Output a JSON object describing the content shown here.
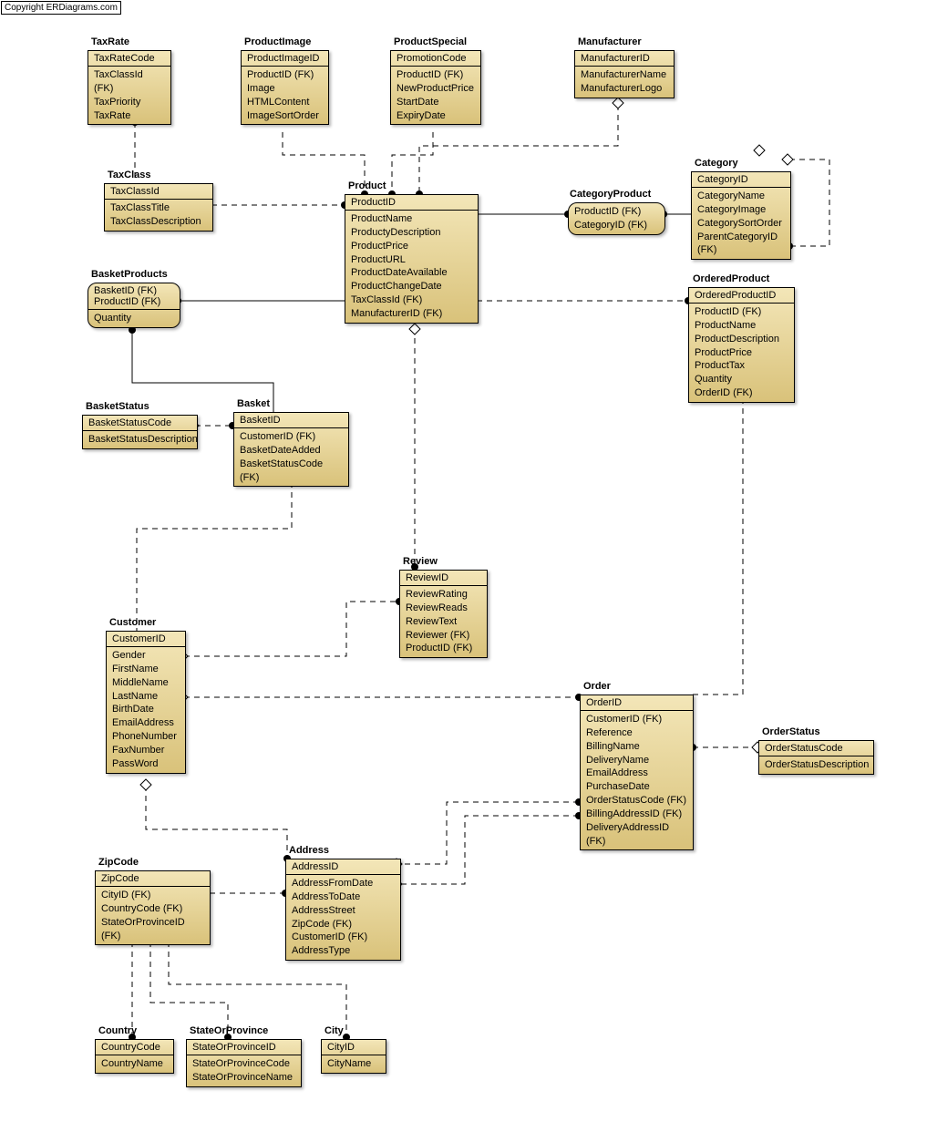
{
  "copyright": "Copyright ERDiagrams.com",
  "entities": {
    "TaxRate": {
      "title": "TaxRate",
      "pk": "TaxRateCode",
      "a1": "TaxClassId (FK)",
      "a2": "TaxPriority",
      "a3": "TaxRate"
    },
    "ProductImage": {
      "title": "ProductImage",
      "pk": "ProductImageID",
      "a1": "ProductID (FK)",
      "a2": "Image",
      "a3": "HTMLContent",
      "a4": "ImageSortOrder"
    },
    "ProductSpecial": {
      "title": "ProductSpecial",
      "pk": "PromotionCode",
      "a1": "ProductID (FK)",
      "a2": "NewProductPrice",
      "a3": "StartDate",
      "a4": "ExpiryDate"
    },
    "Manufacturer": {
      "title": "Manufacturer",
      "pk": "ManufacturerID",
      "a1": "ManufacturerName",
      "a2": "ManufacturerLogo"
    },
    "TaxClass": {
      "title": "TaxClass",
      "pk": "TaxClassId",
      "a1": "TaxClassTitle",
      "a2": "TaxClassDescription"
    },
    "Product": {
      "title": "Product",
      "pk": "ProductID",
      "a1": "ProductName",
      "a2": "ProductyDescription",
      "a3": "ProductPrice",
      "a4": "ProductURL",
      "a5": "ProductDateAvailable",
      "a6": "ProductChangeDate",
      "a7": "TaxClassId (FK)",
      "a8": "ManufacturerID (FK)"
    },
    "CategoryProduct": {
      "title": "CategoryProduct",
      "pk1": "ProductID (FK)",
      "pk2": "CategoryID (FK)"
    },
    "Category": {
      "title": "Category",
      "pk": "CategoryID",
      "a1": "CategoryName",
      "a2": "CategoryImage",
      "a3": "CategorySortOrder",
      "a4": "ParentCategoryID (FK)"
    },
    "BasketProducts": {
      "title": "BasketProducts",
      "pk1": "BasketID (FK)",
      "pk2": "ProductID (FK)",
      "a1": "Quantity"
    },
    "OrderedProduct": {
      "title": "OrderedProduct",
      "pk": "OrderedProductID",
      "a1": "ProductID (FK)",
      "a2": "ProductName",
      "a3": "ProductDescription",
      "a4": "ProductPrice",
      "a5": "ProductTax",
      "a6": "Quantity",
      "a7": "OrderID (FK)"
    },
    "BasketStatus": {
      "title": "BasketStatus",
      "pk": "BasketStatusCode",
      "a1": "BasketStatusDescription"
    },
    "Basket": {
      "title": "Basket",
      "pk": "BasketID",
      "a1": "CustomerID (FK)",
      "a2": "BasketDateAdded",
      "a3": "BasketStatusCode (FK)"
    },
    "Review": {
      "title": "Review",
      "pk": "ReviewID",
      "a1": "ReviewRating",
      "a2": "ReviewReads",
      "a3": "ReviewText",
      "a4": "Reviewer (FK)",
      "a5": "ProductID (FK)"
    },
    "Customer": {
      "title": "Customer",
      "pk": "CustomerID",
      "a1": "Gender",
      "a2": "FirstName",
      "a3": "MiddleName",
      "a4": "LastName",
      "a5": "BirthDate",
      "a6": "EmailAddress",
      "a7": "PhoneNumber",
      "a8": "FaxNumber",
      "a9": "PassWord"
    },
    "Order": {
      "title": "Order",
      "pk": "OrderID",
      "a1": "CustomerID (FK)",
      "a2": "Reference",
      "a3": "BillingName",
      "a4": "DeliveryName",
      "a5": "EmailAddress",
      "a6": "PurchaseDate",
      "a7": "OrderStatusCode (FK)",
      "a8": "BillingAddressID (FK)",
      "a9": "DeliveryAddressID (FK)"
    },
    "OrderStatus": {
      "title": "OrderStatus",
      "pk": "OrderStatusCode",
      "a1": "OrderStatusDescription"
    },
    "ZipCode": {
      "title": "ZipCode",
      "pk": "ZipCode",
      "a1": "CityID (FK)",
      "a2": "CountryCode (FK)",
      "a3": "StateOrProvinceID (FK)"
    },
    "Address": {
      "title": "Address",
      "pk": "AddressID",
      "a1": "AddressFromDate",
      "a2": "AddressToDate",
      "a3": "AddressStreet",
      "a4": "ZipCode (FK)",
      "a5": "CustomerID (FK)",
      "a6": "AddressType"
    },
    "Country": {
      "title": "Country",
      "pk": "CountryCode",
      "a1": "CountryName"
    },
    "StateOrProvince": {
      "title": "StateOrProvince",
      "pk": "StateOrProvinceID",
      "a1": "StateOrProvinceCode",
      "a2": "StateOrProvinceName"
    },
    "City": {
      "title": "City",
      "pk": "CityID",
      "a1": "CityName"
    }
  }
}
